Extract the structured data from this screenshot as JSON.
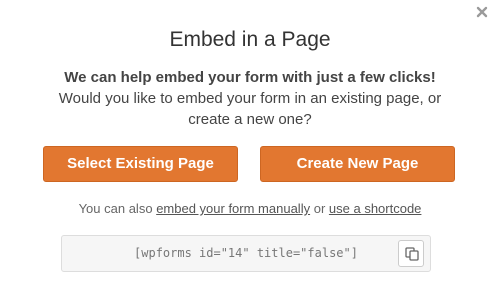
{
  "dialog": {
    "title": "Embed in a Page",
    "lead_bold": "We can help embed your form with just a few clicks!",
    "lead_line_1": "Would you like to embed your form in an existing page, or",
    "lead_line_2": "create a new one?",
    "close_icon": "close-icon"
  },
  "buttons": {
    "select_existing": "Select Existing Page",
    "create_new": "Create New Page",
    "accent_color": "#e27730"
  },
  "alternatives": {
    "prefix": "You can also",
    "manual_link": "embed your form manually",
    "or": "or",
    "shortcode_link": "use a shortcode"
  },
  "shortcode": {
    "value": "[wpforms id=\"14\" title=\"false\"]",
    "copy_icon": "copy-icon"
  }
}
